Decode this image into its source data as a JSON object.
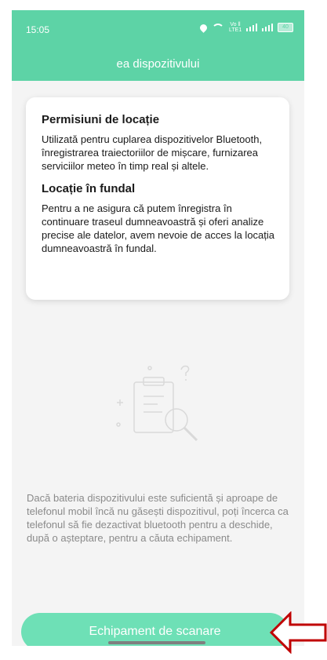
{
  "status_bar": {
    "time": "15:05",
    "volte_label": "Vo ll\nLTE1",
    "battery": "40"
  },
  "header": {
    "title": "ea dispozitivului"
  },
  "permission_card": {
    "section1_title": "Permisiuni de locație",
    "section1_text": "Utilizată pentru cuplarea dispozitivelor Bluetooth, înregistrarea traiectoriilor de mișcare, furnizarea serviciilor meteo în timp real și altele.",
    "section2_title": "Locație în fundal",
    "section2_text": "Pentru a ne asigura că putem înregistra în continuare traseul dumneavoastră și oferi analize precise ale datelor, avem nevoie de acces la locația dumneavoastră în fundal."
  },
  "help_text": "Dacă bateria dispozitivului este suficientă și aproape de telefonul mobil încă nu găsești dispozitivul, poți încerca ca telefonul să fie dezactivat bluetooth pentru a deschide, după o așteptare, pentru a căuta echipament.",
  "scan_button_label": "Echipament de scanare",
  "colors": {
    "accent": "#5dd3a6",
    "button": "#6ee0b6",
    "arrow": "#c00000"
  }
}
